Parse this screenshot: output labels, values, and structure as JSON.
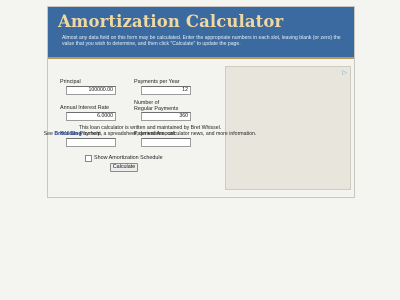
{
  "app": {
    "title": "Amortization Calculator",
    "intro": "Almost any data field on this form may be calculated. Enter the appropriate numbers in each slot, leaving blank (or zero) the value that you wish to determine, and then click \"Calculate\" to update the page."
  },
  "form": {
    "principal": {
      "label": "Principal",
      "value": "100000.00"
    },
    "payments_per_year": {
      "label": "Payments per Year",
      "value": "12"
    },
    "annual_interest_rate": {
      "label": "Annual Interest Rate",
      "value": "6.0000"
    },
    "regular_payments": {
      "label_line1": "Number of",
      "label_line2": "Regular Payments",
      "value": "360"
    },
    "balloon_payment": {
      "label": "Balloon Payment",
      "value": ""
    },
    "payment_amount": {
      "label": "Payment Amount",
      "value": ""
    },
    "show_schedule": {
      "label": "Show Amortization Schedule",
      "checked": false
    },
    "calculate_label": "Calculate"
  },
  "ad": {
    "badge": "▷"
  },
  "footer": {
    "line1": "This loan calculator is written and maintained by Bret Whissel.",
    "line2_prefix": "See",
    "link_text": "Bret's Blog",
    "line2_suffix": "for help, a spreadsheet, derivations, calculator news, and more information."
  },
  "colors": {
    "header_bg": "#3a6aa0",
    "title_color": "#f0d8a2",
    "accent_border": "#b79a59",
    "link_color": "#1a3f9a"
  }
}
